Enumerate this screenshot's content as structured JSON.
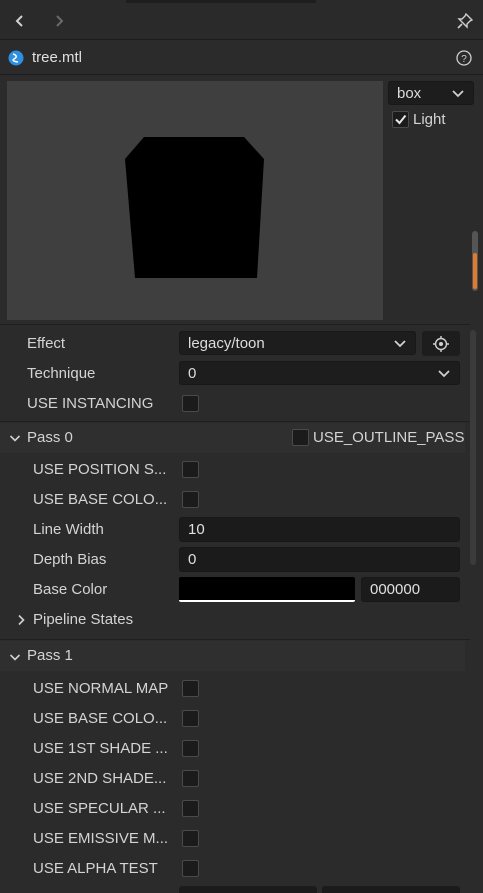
{
  "header": {
    "back_icon": "chevron-left-icon",
    "forward_icon": "chevron-right-icon",
    "pin_icon": "pin-icon"
  },
  "asset": {
    "icon": "material-icon",
    "name": "tree.mtl",
    "help_icon": "help-circle-icon"
  },
  "preview": {
    "shape": "box",
    "light_label": "Light",
    "light_checked": true
  },
  "properties": {
    "effect_label": "Effect",
    "effect_value": "legacy/toon",
    "technique_label": "Technique",
    "technique_value": "0",
    "use_instancing_label": "USE INSTANCING"
  },
  "pass0": {
    "title": "Pass 0",
    "outline_label": "USE_OUTLINE_PASS",
    "use_position_label": "USE POSITION S...",
    "use_base_color_label": "USE BASE COLO...",
    "line_width_label": "Line Width",
    "line_width_value": "10",
    "depth_bias_label": "Depth Bias",
    "depth_bias_value": "0",
    "base_color_label": "Base Color",
    "base_color_hex": "000000",
    "base_color_swatch": "#000000",
    "pipeline_states_label": "Pipeline States"
  },
  "pass1": {
    "title": "Pass 1",
    "items": [
      "USE NORMAL MAP",
      "USE BASE COLO...",
      "USE 1ST SHADE ...",
      "USE 2ND SHADE...",
      "USE SPECULAR ...",
      "USE EMISSIVE M...",
      "USE ALPHA TEST"
    ]
  },
  "colors": {
    "accent": "#e07a2e",
    "panel_bg": "#2b2b2b",
    "input_bg": "#1b1b1b"
  }
}
